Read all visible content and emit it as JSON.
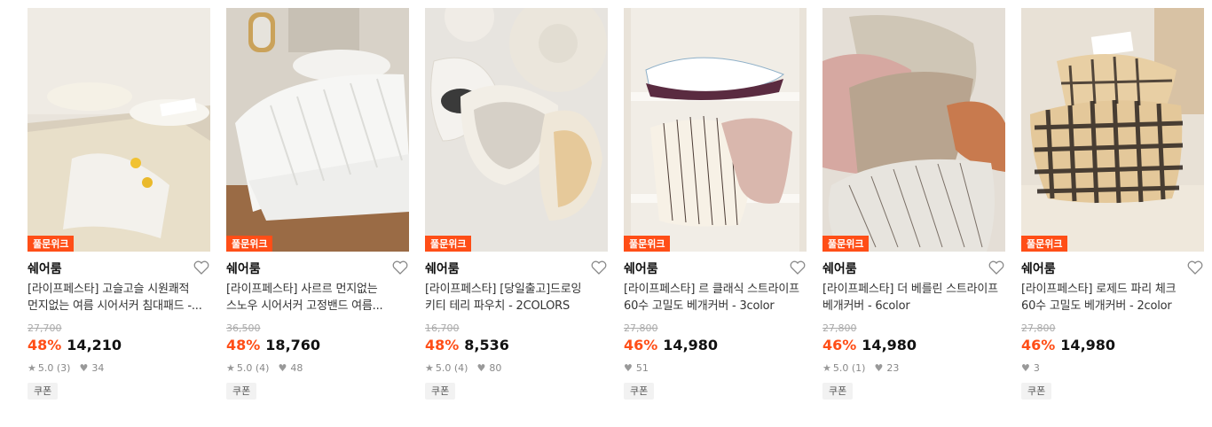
{
  "products": [
    {
      "badge": "풀문위크",
      "brand": "쉐어룸",
      "title_line1": "[라이프페스타] 고슬고슬 시원쾌적",
      "title_line2": "먼지없는 여름 시어서커 침대패드 -...",
      "original_price": "27,700",
      "discount": "48%",
      "price": "14,210",
      "rating": "5.0 (3)",
      "likes": "34",
      "coupon": "쿠폰"
    },
    {
      "badge": "풀문위크",
      "brand": "쉐어룸",
      "title_line1": "[라이프페스타] 사르르 먼지없는",
      "title_line2": "스노우 시어서커 고정밴드 여름...",
      "original_price": "36,500",
      "discount": "48%",
      "price": "18,760",
      "rating": "5.0 (4)",
      "likes": "48",
      "coupon": "쿠폰"
    },
    {
      "badge": "풀문위크",
      "brand": "쉐어룸",
      "title_line1": "[라이프페스타] [당일출고]드로잉",
      "title_line2": "키티 테리 파우치 - 2COLORS",
      "original_price": "16,700",
      "discount": "48%",
      "price": "8,536",
      "rating": "5.0 (4)",
      "likes": "80",
      "coupon": "쿠폰"
    },
    {
      "badge": "풀문위크",
      "brand": "쉐어룸",
      "title_line1": "[라이프페스타] 르 클래식 스트라이프",
      "title_line2": "60수 고밀도 베개커버 - 3color",
      "original_price": "27,800",
      "discount": "46%",
      "price": "14,980",
      "rating": "",
      "likes": "51",
      "coupon": "쿠폰"
    },
    {
      "badge": "풀문위크",
      "brand": "쉐어룸",
      "title_line1": "[라이프페스타] 더 베를린 스트라이프",
      "title_line2": "베개커버 - 6color",
      "original_price": "27,800",
      "discount": "46%",
      "price": "14,980",
      "rating": "5.0 (1)",
      "likes": "23",
      "coupon": "쿠폰"
    },
    {
      "badge": "풀문위크",
      "brand": "쉐어룸",
      "title_line1": "[라이프페스타] 로제드 파리 체크",
      "title_line2": "60수 고밀도 베개커버 - 2color",
      "original_price": "27,800",
      "discount": "46%",
      "price": "14,980",
      "rating": "",
      "likes": "3",
      "coupon": "쿠폰"
    }
  ],
  "colors": {
    "accent": "#ff4e17",
    "text": "#111111",
    "muted": "#888888"
  }
}
